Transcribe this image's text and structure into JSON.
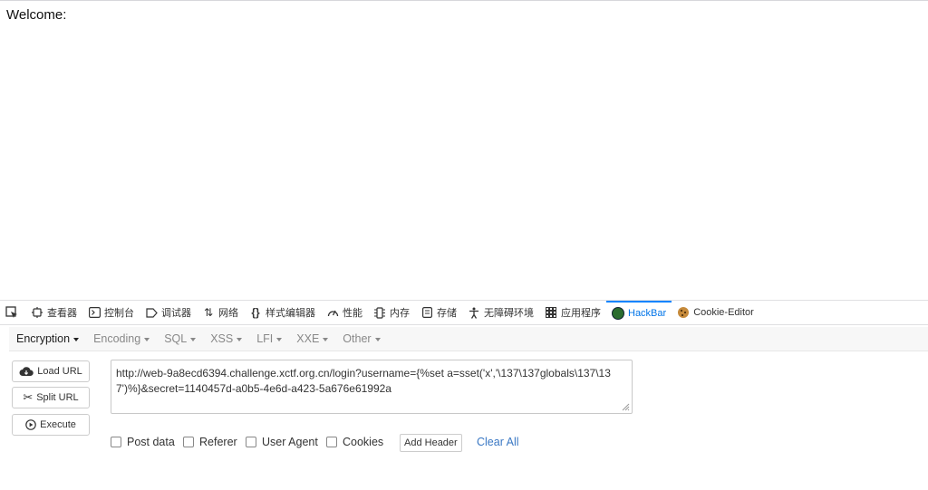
{
  "page": {
    "welcome_text": "Welcome:"
  },
  "devtools": {
    "tabs": [
      {
        "label": "查看器",
        "icon": "inspector-icon"
      },
      {
        "label": "控制台",
        "icon": "console-icon"
      },
      {
        "label": "调试器",
        "icon": "debugger-icon"
      },
      {
        "label": "网络",
        "icon": "network-icon"
      },
      {
        "label": "样式编辑器",
        "icon": "style-editor-icon"
      },
      {
        "label": "性能",
        "icon": "performance-icon"
      },
      {
        "label": "内存",
        "icon": "memory-icon"
      },
      {
        "label": "存储",
        "icon": "storage-icon"
      },
      {
        "label": "无障碍环境",
        "icon": "accessibility-icon"
      },
      {
        "label": "应用程序",
        "icon": "application-icon"
      },
      {
        "label": "HackBar",
        "icon": "hackbar-icon",
        "active": true
      },
      {
        "label": "Cookie-Editor",
        "icon": "cookie-icon"
      }
    ]
  },
  "hackbar": {
    "menu": [
      "Encryption",
      "Encoding",
      "SQL",
      "XSS",
      "LFI",
      "XXE",
      "Other"
    ],
    "buttons": {
      "load_url": "Load URL",
      "split_url": "Split URL",
      "execute": "Execute"
    },
    "url": "http://web-9a8ecd6394.challenge.xctf.org.cn/login?username={%set a=sset('x','\\137\\137globals\\137\\137')%}&secret=1140457d-a0b5-4e6d-a423-5a676e61992a",
    "options": {
      "post_data": "Post data",
      "referer": "Referer",
      "user_agent": "User Agent",
      "cookies": "Cookies"
    },
    "add_header": "Add Header",
    "clear_all": "Clear All",
    "colors": {
      "active_tab": "#0074e8",
      "link": "#3a78c4"
    }
  }
}
